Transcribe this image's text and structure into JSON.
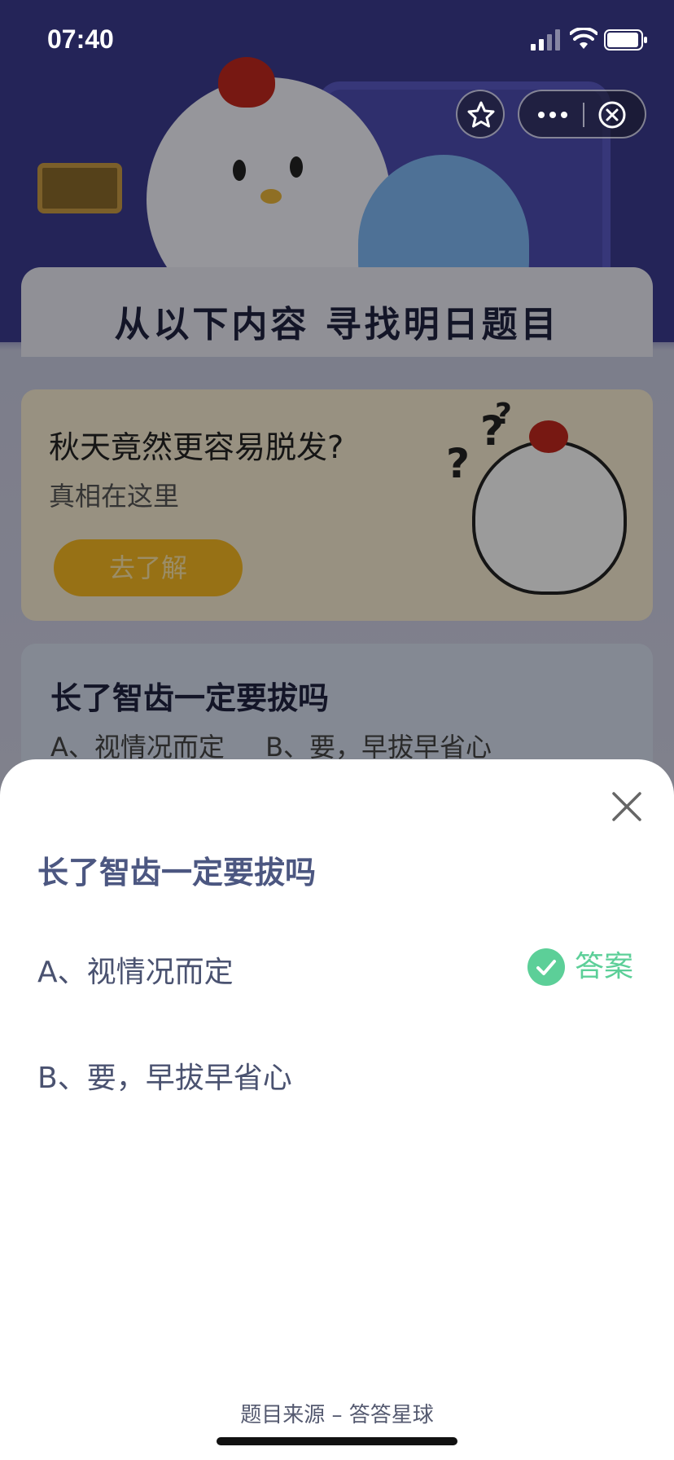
{
  "status_bar": {
    "time": "07:40"
  },
  "background": {
    "heading": "从以下内容  寻找明日题目",
    "promo": {
      "title": "秋天竟然更容易脱发?",
      "subtitle": "真相在这里",
      "button": "去了解"
    },
    "question_card": {
      "title": "长了智齿一定要拔吗",
      "options": "A、视情况而定    B、要，早拔早省心"
    }
  },
  "capsule": {
    "icons": [
      "star-icon",
      "more-icon",
      "exit-icon"
    ]
  },
  "sheet": {
    "question": "长了智齿一定要拔吗",
    "options": [
      {
        "label": "A、视情况而定",
        "is_answer": true
      },
      {
        "label": "B、要，早拔早省心",
        "is_answer": false
      }
    ],
    "answer_label": "答案",
    "footer": "题目来源 – 答答星球"
  },
  "colors": {
    "answer_green": "#5ccf98",
    "question_text": "#4c5781",
    "promo_button": "#f4b623"
  }
}
